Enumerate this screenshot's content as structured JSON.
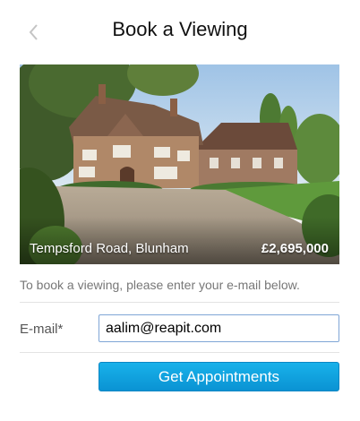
{
  "header": {
    "title": "Book a Viewing",
    "back_icon": "chevron-left-icon"
  },
  "property": {
    "address": "Tempsford Road, Blunham",
    "price": "£2,695,000"
  },
  "form": {
    "instructions": "To book a viewing, please enter your e-mail below.",
    "email_label": "E-mail*",
    "email_value": "aalim@reapit.com",
    "submit_label": "Get Appointments"
  },
  "colors": {
    "accent": "#0a9ad9",
    "input_border": "#7fa6d6"
  }
}
